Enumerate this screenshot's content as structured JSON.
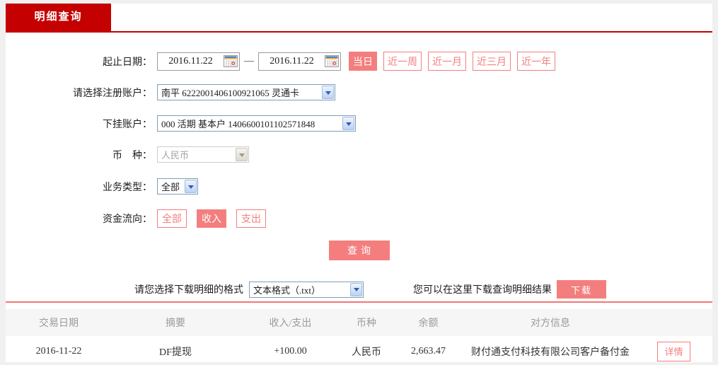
{
  "page": {
    "tab_label": "明细查询"
  },
  "form": {
    "date_range": {
      "label": "起止日期：",
      "start_value": "2016.11.22",
      "end_value": "2016.11.22",
      "separator": "—",
      "quick_buttons": [
        {
          "label": "当日",
          "active": true
        },
        {
          "label": "近一周",
          "active": false
        },
        {
          "label": "近一月",
          "active": false
        },
        {
          "label": "近三月",
          "active": false
        },
        {
          "label": "近一年",
          "active": false
        }
      ]
    },
    "registered_account": {
      "label": "请选择注册账户：",
      "value": "南平 6222001406100921065 灵通卡"
    },
    "sub_account": {
      "label": "下挂账户：",
      "value": "000 活期 基本户 1406600101102571848"
    },
    "currency": {
      "label": "币　种：",
      "value": "人民币",
      "disabled": true
    },
    "business_type": {
      "label": "业务类型：",
      "value": "全部"
    },
    "fund_flow": {
      "label": "资金流向：",
      "options": [
        {
          "label": "全部",
          "active": false
        },
        {
          "label": "收入",
          "active": true
        },
        {
          "label": "支出",
          "active": false
        }
      ]
    },
    "query_button_label": "查询",
    "download": {
      "format_label": "请您选择下载明细的格式",
      "format_value": "文本格式（.txt）",
      "hint": "您可以在这里下载查询明细结果",
      "button_label": "下载"
    }
  },
  "table": {
    "headers": [
      "交易日期",
      "摘要",
      "收入/支出",
      "币种",
      "余额",
      "对方信息"
    ],
    "rows": [
      {
        "date": "2016-11-22",
        "summary": "DF提现",
        "amount": "+100.00",
        "currency": "人民币",
        "balance": "2,663.47",
        "counterparty": "财付通支付科技有限公司客户备付金",
        "detail_label": "详情"
      }
    ]
  },
  "colors": {
    "brand_red": "#c40000",
    "accent_salmon": "#f47e7e",
    "amount_positive_red": "#cc0000"
  }
}
